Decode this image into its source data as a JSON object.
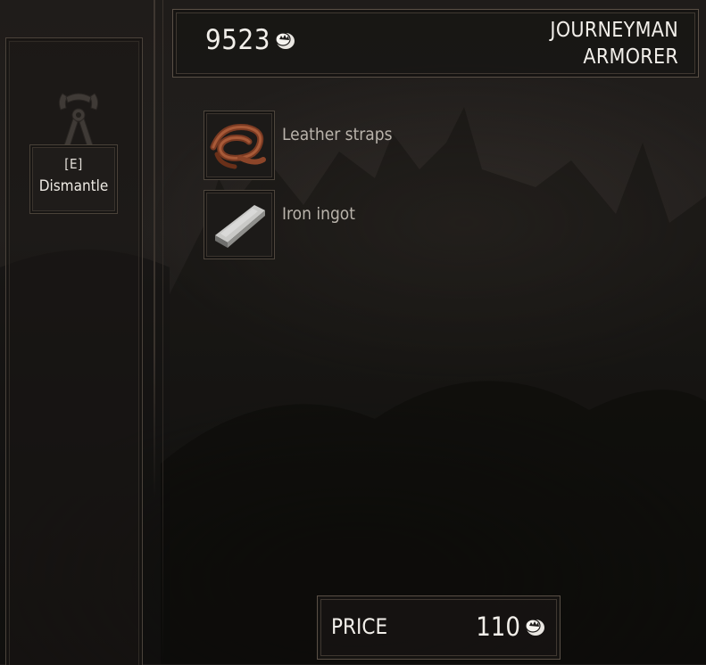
{
  "header": {
    "money": "9523",
    "money_icon": "crowns-coin-icon",
    "craftsman_line1": "JOURNEYMAN",
    "craftsman_line2": "ARMORER"
  },
  "left_panel": {
    "tool_icon": "pincers-icon",
    "dismantle_key": "[E]",
    "dismantle_label": "Dismantle"
  },
  "components": [
    {
      "name": "Leather straps",
      "icon": "leather-straps-icon"
    },
    {
      "name": "Iron ingot",
      "icon": "iron-ingot-icon"
    }
  ],
  "price": {
    "label": "PRICE",
    "value": "110",
    "icon": "crowns-coin-icon"
  },
  "colors": {
    "text": "#f2efea",
    "muted_text": "#b9b3ab",
    "frame": "#5a5046"
  }
}
